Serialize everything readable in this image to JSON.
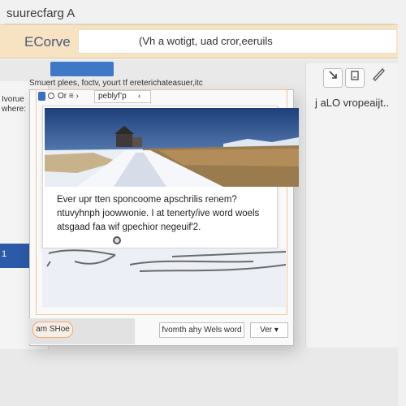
{
  "window": {
    "title": "suurecfarg A"
  },
  "app": {
    "name": "ECorve",
    "search_value": "(Vh a wotigt, uad cror,eeruils"
  },
  "sidebar": {
    "label": "Ivorue where:",
    "active_tab": "1"
  },
  "hint_text": "Smuert plees, foctv, yourt tf ereterichateasuer,itc",
  "toolbar_right": {
    "label": "j  aLO vropeaijt..",
    "icons": [
      "arrow-down-icon",
      "document-icon",
      "pen-icon"
    ]
  },
  "dialog": {
    "toolbar": {
      "icons": [
        "blue-square-icon",
        "circle-icon"
      ],
      "label": "Or ≡ ›",
      "field_value": "peblyf’p",
      "field_arrow": "‹"
    },
    "card": {
      "image": "snowy-road-landscape",
      "text": "Ever upr tten sponcoome apschrilis renem? ntuvyhnph joowwonie. I at tenerty/ive word woels atsgaad faa wif gpechior negeuif'2."
    },
    "buttons": {
      "save_label": "am SHoe",
      "word_label": "fvomth ahy Wels word",
      "ok_label": "Ver ▾"
    }
  },
  "colors": {
    "header_bg": "#f7e2c2",
    "accent_blue": "#3f78c7",
    "highlight_orange": "#f2a56e"
  }
}
